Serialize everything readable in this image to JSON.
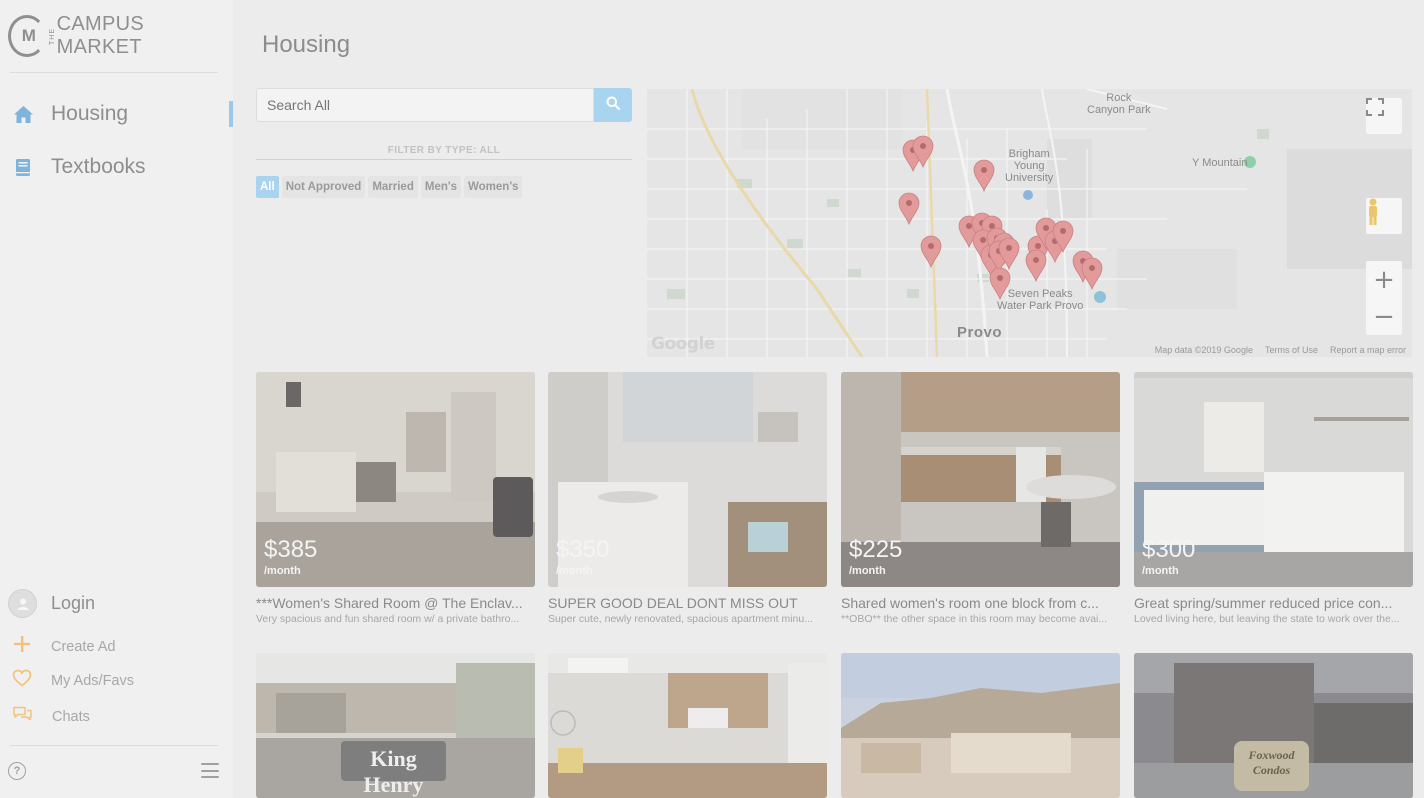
{
  "brand": {
    "logo_letter": "M",
    "logo_the": "THE",
    "name": "CAMPUS MARKET"
  },
  "sidebar": {
    "items": [
      {
        "label": "Housing",
        "icon": "home-icon",
        "active": true
      },
      {
        "label": "Textbooks",
        "icon": "book-icon",
        "active": false
      }
    ],
    "login_label": "Login",
    "secondary": [
      {
        "label": "Create Ad",
        "icon": "plus-icon"
      },
      {
        "label": "My Ads/Favs",
        "icon": "heart-icon"
      },
      {
        "label": "Chats",
        "icon": "chat-icon"
      }
    ],
    "help_glyph": "?"
  },
  "page": {
    "title": "Housing"
  },
  "search": {
    "placeholder": "Search All"
  },
  "filter": {
    "label": "FILTER BY TYPE: ALL",
    "options": [
      "All",
      "Not Approved",
      "Married",
      "Men's",
      "Women's"
    ],
    "selected": "All"
  },
  "map": {
    "labels": {
      "rock_canyon": "Rock\nCanyon Park",
      "byu": "Brigham\nYoung\nUniversity",
      "y_mountain": "Y Mountain",
      "seven_peaks": "Seven Peaks\nWater Park Provo",
      "provo": "Provo"
    },
    "google": "Google",
    "footer": [
      "Map data ©2019 Google",
      "Terms of Use",
      "Report a map error"
    ],
    "zoom_in": "+",
    "zoom_out": "−",
    "marker_color": "#e39a9a"
  },
  "listings": [
    {
      "price": "$385",
      "period": "/month",
      "title": "***Women's Shared Room @ The Enclav...",
      "desc": "Very spacious and fun shared room w/ a private bathro..."
    },
    {
      "price": "$350",
      "period": "/month",
      "title": "SUPER GOOD DEAL DONT MISS OUT",
      "desc": "Super cute, newly renovated, spacious apartment minu..."
    },
    {
      "price": "$225",
      "period": "/month",
      "title": "Shared women's room one block from c...",
      "desc": "**OBO** the other space in this room may become avai..."
    },
    {
      "price": "$300",
      "period": "/month",
      "title": "Great spring/summer reduced price con...",
      "desc": "Loved living here, but leaving the state to work over the..."
    }
  ],
  "row2_signs": [
    "King Henry",
    "Foxwood\nCondos"
  ],
  "colors": {
    "accent": "#a8d4ef",
    "background": "#ececec"
  }
}
